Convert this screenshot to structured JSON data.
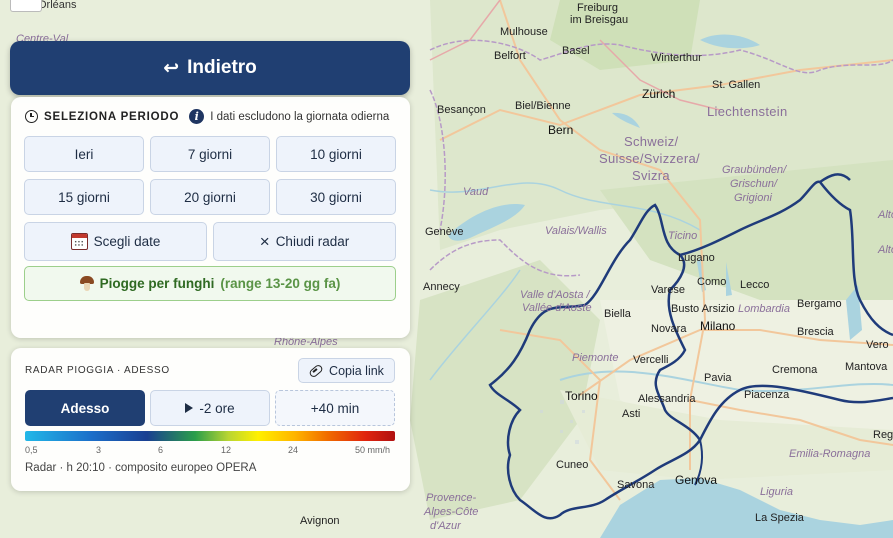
{
  "back_button": {
    "label": "Indietro",
    "icon": "back-arrow-icon"
  },
  "period": {
    "title": "SELEZIONA PERIODO",
    "note": "I dati escludono la giornata odierna",
    "buttons": [
      "Ieri",
      "7 giorni",
      "10 giorni",
      "15 giorni",
      "20 giorni",
      "30 giorni"
    ],
    "choose_dates": "Scegli date",
    "close_radar": "Chiudi radar",
    "close_icon": "×",
    "mushroom": {
      "label": "Piogge per funghi",
      "range": "(range 13-20 gg fa)"
    }
  },
  "radar": {
    "title": "RADAR PIOGGIA · ADESSO",
    "copy_link": "Copia link",
    "buttons": {
      "now": "Adesso",
      "minus2": "-2 ore",
      "plus40": "+40 min"
    },
    "scale": [
      "0,5",
      "3",
      "6",
      "12",
      "24",
      "50 mm/h"
    ],
    "footer": "Radar · h 20:10 · composito europeo OPERA"
  },
  "map": {
    "labels": {
      "orleans": "Orléans",
      "centre_val": "Centre-Val",
      "freiburg": "Freiburg",
      "im_breisgau": "im Breisgau",
      "mulhouse": "Mulhouse",
      "basel": "Basel",
      "belfort": "Belfort",
      "winterthur": "Winterthur",
      "zurich": "Zürich",
      "st_gallen": "St. Gallen",
      "liechtenstein": "Liechtenstein",
      "biel": "Biel/Bienne",
      "besancon": "Besançon",
      "bern": "Bern",
      "schweiz": "Schweiz/",
      "suisse": "Suisse/Svizzera/",
      "svizra": "Svizra",
      "graubunden": "Graubünden/",
      "grischun": "Grischun/",
      "grigioni": "Grigioni",
      "vaud": "Vaud",
      "geneve": "Genève",
      "valais": "Valais/Wallis",
      "ticino": "Ticino",
      "lugano": "Lugano",
      "varese": "Varese",
      "como": "Como",
      "lecco": "Lecco",
      "annecy": "Annecy",
      "valle_aosta1": "Valle d'Aosta /",
      "valle_aosta2": "Vallée d'Aoste",
      "biella": "Biella",
      "busto": "Busto Arsizio",
      "lombardia": "Lombardia",
      "bergamo": "Bergamo",
      "brescia": "Brescia",
      "novara": "Novara",
      "milano": "Milano",
      "vercelli": "Vercelli",
      "piemonte": "Piemonte",
      "pavia": "Pavia",
      "cremona": "Cremona",
      "mantova": "Mantova",
      "verona": "Vero",
      "torino": "Torino",
      "alessandria": "Alessandria",
      "piacenza": "Piacenza",
      "asti": "Asti",
      "reggio": "Reggio",
      "emilia_romagna": "Emilia-Romagna",
      "cuneo": "Cuneo",
      "genova": "Genova",
      "savona": "Savona",
      "liguria": "Liguria",
      "la_spezia": "La Spezia",
      "provence1": "Provence-",
      "provence2": "Alpes-Côte",
      "provence3": "d'Azur",
      "avignon": "Avignon",
      "rhone_alpes": "Rhône-Alpes",
      "alto1": "Alto",
      "alto2": "Alto"
    }
  },
  "colors": {
    "primary": "#203f72",
    "accent_green": "#2f6a22",
    "border_line": "#1f3b7a"
  }
}
